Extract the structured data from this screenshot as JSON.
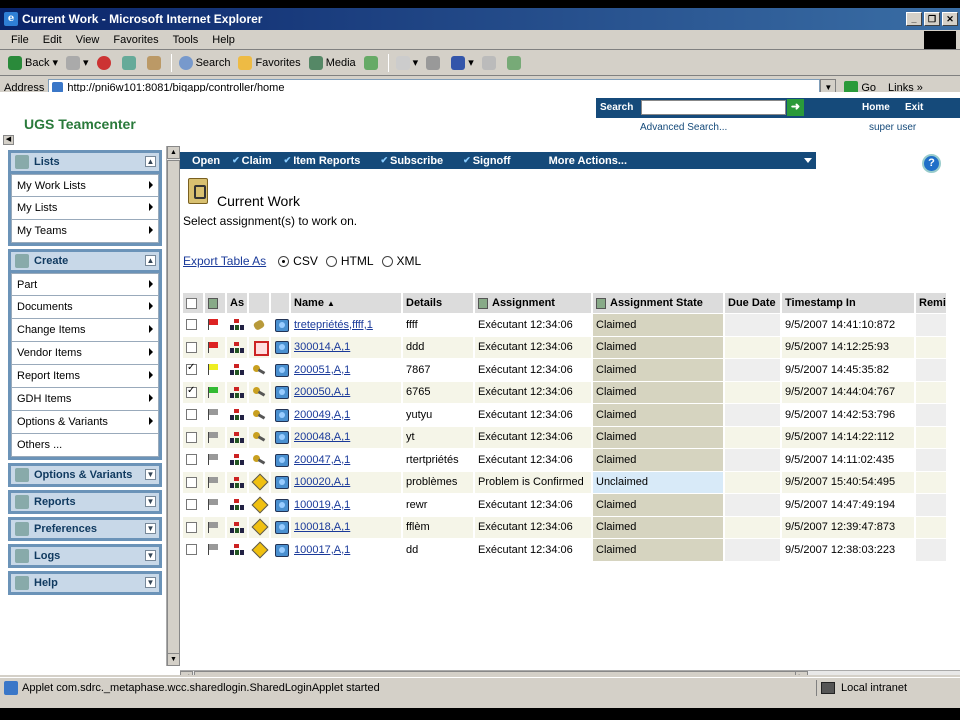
{
  "window": {
    "title": "Current Work - Microsoft Internet Explorer"
  },
  "menubar": [
    "File",
    "Edit",
    "View",
    "Favorites",
    "Tools",
    "Help"
  ],
  "toolbar": {
    "back": "Back",
    "search": "Search",
    "favorites": "Favorites",
    "media": "Media"
  },
  "address": {
    "label": "Address",
    "url": "http://pni6w101:8081/bigapp/controller/home",
    "go": "Go",
    "links": "Links"
  },
  "header": {
    "brand": "UGS Teamcenter",
    "search_label": "Search",
    "home": "Home",
    "exit": "Exit",
    "advanced_search": "Advanced Search...",
    "user": "super user"
  },
  "sidebar": {
    "panels": [
      {
        "title": "Lists",
        "toggle": "▲",
        "items": [
          "My Work Lists",
          "My Lists",
          "My Teams"
        ]
      },
      {
        "title": "Create",
        "toggle": "▲",
        "items": [
          "Part",
          "Documents",
          "Change Items",
          "Vendor Items",
          "Report Items",
          "GDH Items",
          "Options & Variants",
          "Others ..."
        ]
      },
      {
        "title": "Options & Variants",
        "toggle": "▼",
        "items": []
      },
      {
        "title": "Reports",
        "toggle": "▼",
        "items": []
      },
      {
        "title": "Preferences",
        "toggle": "▼",
        "items": []
      },
      {
        "title": "Logs",
        "toggle": "▼",
        "items": []
      },
      {
        "title": "Help",
        "toggle": "▼",
        "items": []
      }
    ]
  },
  "actions": {
    "open": "Open",
    "claim": "Claim",
    "item_reports": "Item Reports",
    "subscribe": "Subscribe",
    "signoff": "Signoff",
    "more": "More Actions..."
  },
  "page": {
    "title": "Current Work",
    "subtitle": "Select assignment(s) to work on.",
    "export_label": "Export Table As",
    "export_options": [
      "CSV",
      "HTML",
      "XML"
    ],
    "export_selected": "CSV"
  },
  "table": {
    "headers": {
      "as": "As",
      "name": "Name",
      "details": "Details",
      "assignment": "Assignment",
      "assignment_state": "Assignment State",
      "due_date": "Due Date",
      "timestamp": "Timestamp In",
      "remaining": "Remi"
    },
    "rows": [
      {
        "checked": false,
        "flag": "red",
        "type": "tool",
        "name": "tretepriétés,ffff,1",
        "details": "ffff",
        "assignment": "Exécutant 12:34:06",
        "state": "Claimed",
        "timestamp": "9/5/2007 14:41:10:872"
      },
      {
        "checked": false,
        "flag": "red",
        "type": "redbox",
        "name": "300014,A,1",
        "details": "ddd",
        "assignment": "Exécutant 12:34:06",
        "state": "Claimed",
        "timestamp": "9/5/2007 14:12:25:93"
      },
      {
        "checked": true,
        "flag": "yellow",
        "type": "key",
        "name": "200051,A,1",
        "details": "7867",
        "assignment": "Exécutant 12:34:06",
        "state": "Claimed",
        "timestamp": "9/5/2007 14:45:35:82"
      },
      {
        "checked": true,
        "flag": "green",
        "type": "key",
        "name": "200050,A,1",
        "details": "6765",
        "assignment": "Exécutant 12:34:06",
        "state": "Claimed",
        "timestamp": "9/5/2007 14:44:04:767"
      },
      {
        "checked": false,
        "flag": "gray",
        "type": "key",
        "name": "200049,A,1",
        "details": "yutyu",
        "assignment": "Exécutant 12:34:06",
        "state": "Claimed",
        "timestamp": "9/5/2007 14:42:53:796"
      },
      {
        "checked": false,
        "flag": "gray",
        "type": "key",
        "name": "200048,A,1",
        "details": "yt",
        "assignment": "Exécutant 12:34:06",
        "state": "Claimed",
        "timestamp": "9/5/2007 14:14:22:112"
      },
      {
        "checked": false,
        "flag": "gray",
        "type": "key",
        "name": "200047,A,1",
        "details": "rtertpriétés",
        "assignment": "Exécutant 12:34:06",
        "state": "Claimed",
        "timestamp": "9/5/2007 14:11:02:435"
      },
      {
        "checked": false,
        "flag": "gray",
        "type": "diamond",
        "name": "100020,A,1",
        "details": "problèmes",
        "assignment": "Problem is Confirmed",
        "state": "Unclaimed",
        "timestamp": "9/5/2007 15:40:54:495"
      },
      {
        "checked": false,
        "flag": "gray",
        "type": "diamond",
        "name": "100019,A,1",
        "details": "rewr",
        "assignment": "Exécutant 12:34:06",
        "state": "Claimed",
        "timestamp": "9/5/2007 14:47:49:194"
      },
      {
        "checked": false,
        "flag": "gray",
        "type": "diamond",
        "name": "100018,A,1",
        "details": "fflèm",
        "assignment": "Exécutant 12:34:06",
        "state": "Claimed",
        "timestamp": "9/5/2007 12:39:47:873"
      },
      {
        "checked": false,
        "flag": "gray",
        "type": "diamond",
        "name": "100017,A,1",
        "details": "dd",
        "assignment": "Exécutant 12:34:06",
        "state": "Claimed",
        "timestamp": "9/5/2007 12:38:03:223"
      }
    ]
  },
  "status": {
    "text": "Applet com.sdrc._metaphase.wcc.sharedlogin.SharedLoginApplet started",
    "zone": "Local intranet"
  }
}
